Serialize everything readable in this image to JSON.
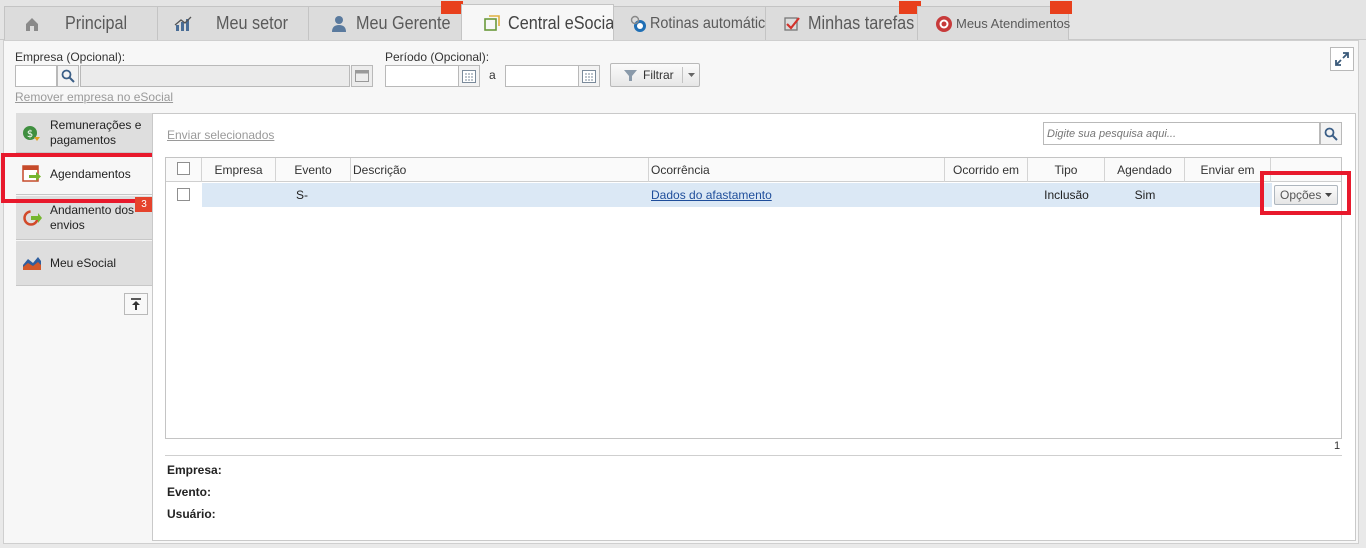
{
  "tabs": [
    {
      "label": "Principal",
      "icon": "home-icon"
    },
    {
      "label": "Meu setor",
      "icon": "chart-icon"
    },
    {
      "label": "Meu Gerente",
      "icon": "person-icon"
    },
    {
      "label": "Central eSocial",
      "icon": "esocial-icon"
    },
    {
      "label": "Rotinas automáticas",
      "icon": "clock-gear-icon"
    },
    {
      "label": "Minhas tarefas",
      "icon": "checkbox-icon"
    },
    {
      "label": "Meus Atendimentos",
      "icon": "support-icon"
    }
  ],
  "filters": {
    "empresa_label": "Empresa (Opcional):",
    "periodo_label": "Período (Opcional):",
    "periodo_sep": "a",
    "filter_button": "Filtrar",
    "remove_link": "Remover empresa no eSocial"
  },
  "sidebar": {
    "items": [
      {
        "label": "Remunerações e pagamentos",
        "icon": "money-icon"
      },
      {
        "label": "Agendamentos",
        "icon": "calendar-arrow-icon",
        "badge": "3"
      },
      {
        "label": "Andamento dos envios",
        "icon": "refresh-arrow-icon"
      },
      {
        "label": "Meu eSocial",
        "icon": "area-chart-icon"
      }
    ]
  },
  "toolbar": {
    "send_selected": "Enviar selecionados",
    "search_placeholder": "Digite sua pesquisa aqui..."
  },
  "table": {
    "columns": [
      "Empresa",
      "Evento",
      "Descrição",
      "Ocorrência",
      "Ocorrido em",
      "Tipo",
      "Agendado",
      "Enviar em"
    ],
    "rows": [
      {
        "empresa": "",
        "evento": "S-",
        "descricao": "",
        "ocorrencia": "Dados do afastamento",
        "ocorrido_em": "",
        "tipo": "Inclusão",
        "agendado": "Sim",
        "enviar_em": "",
        "action": "Opções"
      }
    ],
    "page": "1"
  },
  "details": {
    "empresa": "Empresa:",
    "evento": "Evento:",
    "usuario": "Usuário:"
  },
  "colors": {
    "highlight": "#e8192c",
    "tab_flag": "#e8401c",
    "row_selected": "#dbe8f5"
  }
}
